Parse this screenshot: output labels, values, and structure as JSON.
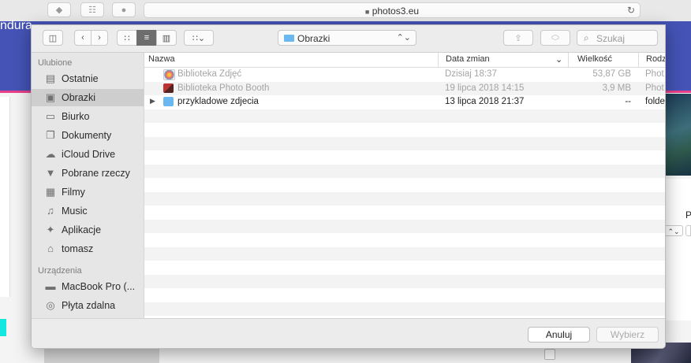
{
  "browser": {
    "url": "photos3.eu",
    "icons": [
      "shield-icon",
      "reader-icon",
      "extension-icon",
      "lock-icon",
      "reload-icon"
    ]
  },
  "page": {
    "hero_text": "ndura",
    "right_letter": "P"
  },
  "dialog": {
    "location": "Obrazki",
    "search_placeholder": "Szukaj",
    "sidebar": {
      "favorites_header": "Ulubione",
      "favorites": [
        {
          "label": "Ostatnie",
          "icon": "recents-icon"
        },
        {
          "label": "Obrazki",
          "icon": "camera-icon",
          "selected": true
        },
        {
          "label": "Biurko",
          "icon": "desktop-icon"
        },
        {
          "label": "Dokumenty",
          "icon": "documents-icon"
        },
        {
          "label": "iCloud Drive",
          "icon": "cloud-icon"
        },
        {
          "label": "Pobrane rzeczy",
          "icon": "downloads-icon"
        },
        {
          "label": "Filmy",
          "icon": "film-icon"
        },
        {
          "label": "Music",
          "icon": "music-icon"
        },
        {
          "label": "Aplikacje",
          "icon": "apps-icon"
        },
        {
          "label": "tomasz",
          "icon": "home-icon"
        }
      ],
      "devices_header": "Urządzenia",
      "devices": [
        {
          "label": "MacBook Pro (...",
          "icon": "laptop-icon"
        },
        {
          "label": "Płyta zdalna",
          "icon": "disc-icon"
        }
      ]
    },
    "columns": {
      "name": "Nazwa",
      "date": "Data zmian",
      "size": "Wielkość",
      "kind": "Rodz"
    },
    "files": [
      {
        "name": "Biblioteka Zdjęć",
        "date": "Dzisiaj 18:37",
        "size": "53,87 GB",
        "kind": "Phot",
        "disabled": true,
        "icon": "photos-library-icon"
      },
      {
        "name": "Biblioteka Photo Booth",
        "date": "19 lipca 2018 14:15",
        "size": "3,9 MB",
        "kind": "Phot",
        "disabled": true,
        "icon": "photobooth-library-icon"
      },
      {
        "name": "przykladowe zdjecia",
        "date": "13 lipca 2018 21:37",
        "size": "--",
        "kind": "folde",
        "disabled": false,
        "icon": "folder-icon"
      }
    ],
    "buttons": {
      "cancel": "Anuluj",
      "choose": "Wybierz"
    }
  }
}
